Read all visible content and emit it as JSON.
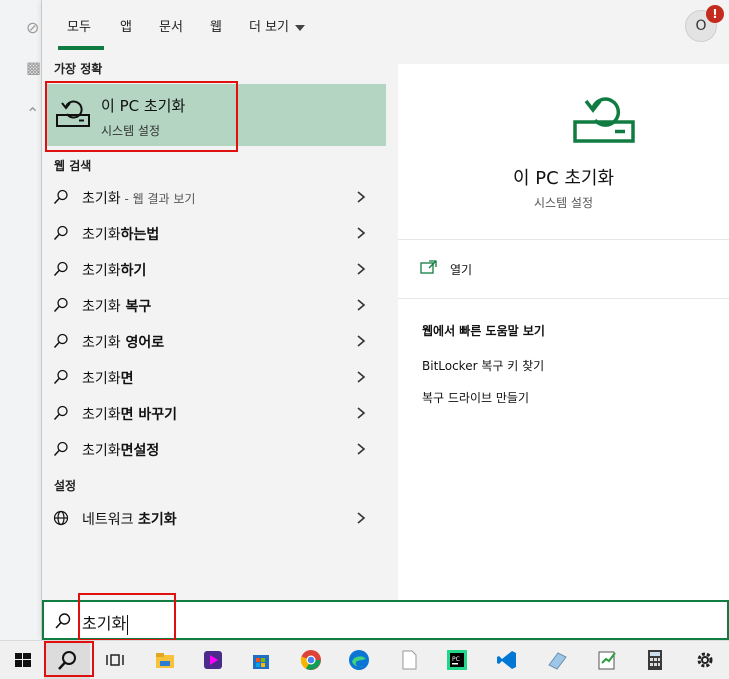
{
  "tabs": [
    {
      "label": "모두"
    },
    {
      "label": "앱"
    },
    {
      "label": "문서"
    },
    {
      "label": "웹"
    },
    {
      "label": "더 보기"
    }
  ],
  "avatar": {
    "initial": "O",
    "badge": "!"
  },
  "best_match": {
    "section": "가장 정확",
    "title": "이 PC 초기화",
    "subtitle": "시스템 설정"
  },
  "web_search": {
    "section": "웹 검색",
    "items": [
      {
        "prefix": "초기화",
        "bold": "",
        "suffix": " - 웹 결과 보기"
      },
      {
        "prefix": "초기화",
        "bold": "하는법",
        "suffix": ""
      },
      {
        "prefix": "초기화",
        "bold": "하기",
        "suffix": ""
      },
      {
        "prefix": "초기화",
        "bold": " 복구",
        "suffix": ""
      },
      {
        "prefix": "초기화",
        "bold": " 영어로",
        "suffix": ""
      },
      {
        "prefix": "초기화",
        "bold": "면",
        "suffix": ""
      },
      {
        "prefix": "초기화",
        "bold": "면 바꾸기",
        "suffix": ""
      },
      {
        "prefix": "초기화",
        "bold": "면설정",
        "suffix": ""
      }
    ]
  },
  "settings": {
    "section": "설정",
    "items": [
      {
        "prefix": "네트워크 ",
        "bold": "초기화",
        "suffix": ""
      }
    ]
  },
  "detail": {
    "title": "이 PC 초기화",
    "subtitle": "시스템 설정",
    "open_label": "열기",
    "web_help_title": "웹에서 빠른 도움말 보기",
    "links": [
      "BitLocker 복구 키 찾기",
      "복구 드라이브 만들기"
    ]
  },
  "search": {
    "value": "초기화"
  },
  "colors": {
    "accent": "#107c41",
    "best_bg": "#b3d5c2",
    "highlight_box": "#e01010"
  },
  "taskbar_icons": [
    "windows-start-icon",
    "search-icon",
    "task-view-icon",
    "file-explorer-icon",
    "media-player-icon",
    "store-icon",
    "chrome-icon",
    "edge-icon",
    "notepad-icon",
    "pycharm-icon",
    "vscode-icon",
    "eraser-icon",
    "notes-icon",
    "calculator-icon",
    "settings-gear-icon"
  ]
}
